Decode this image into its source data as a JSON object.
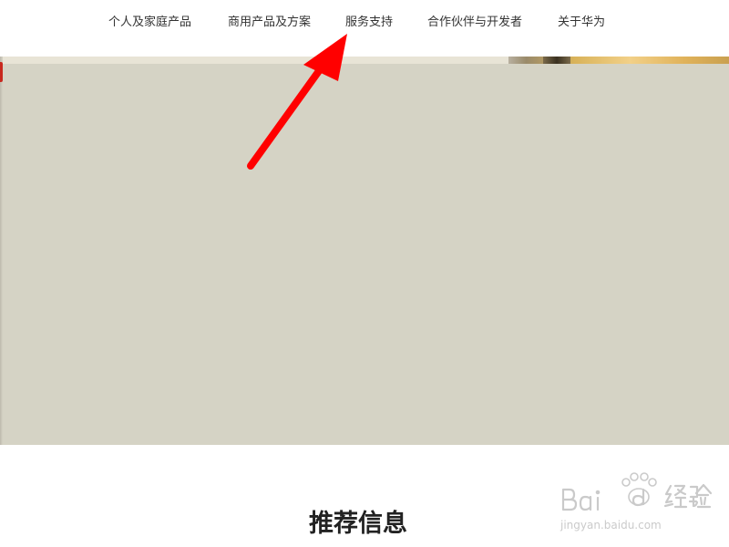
{
  "nav": {
    "items": [
      {
        "label": "个人及家庭产品"
      },
      {
        "label": "商用产品及方案"
      },
      {
        "label": "服务支持"
      },
      {
        "label": "合作伙伴与开发者"
      },
      {
        "label": "关于华为"
      }
    ]
  },
  "hero": {
    "background_color": "#d5d3c5"
  },
  "section": {
    "title": "推荐信息"
  },
  "annotation": {
    "arrow_color": "#ff0000",
    "points_to": "服务支持"
  },
  "watermark": {
    "brand": "Baidu经验",
    "url": "jingyan.baidu.com"
  }
}
